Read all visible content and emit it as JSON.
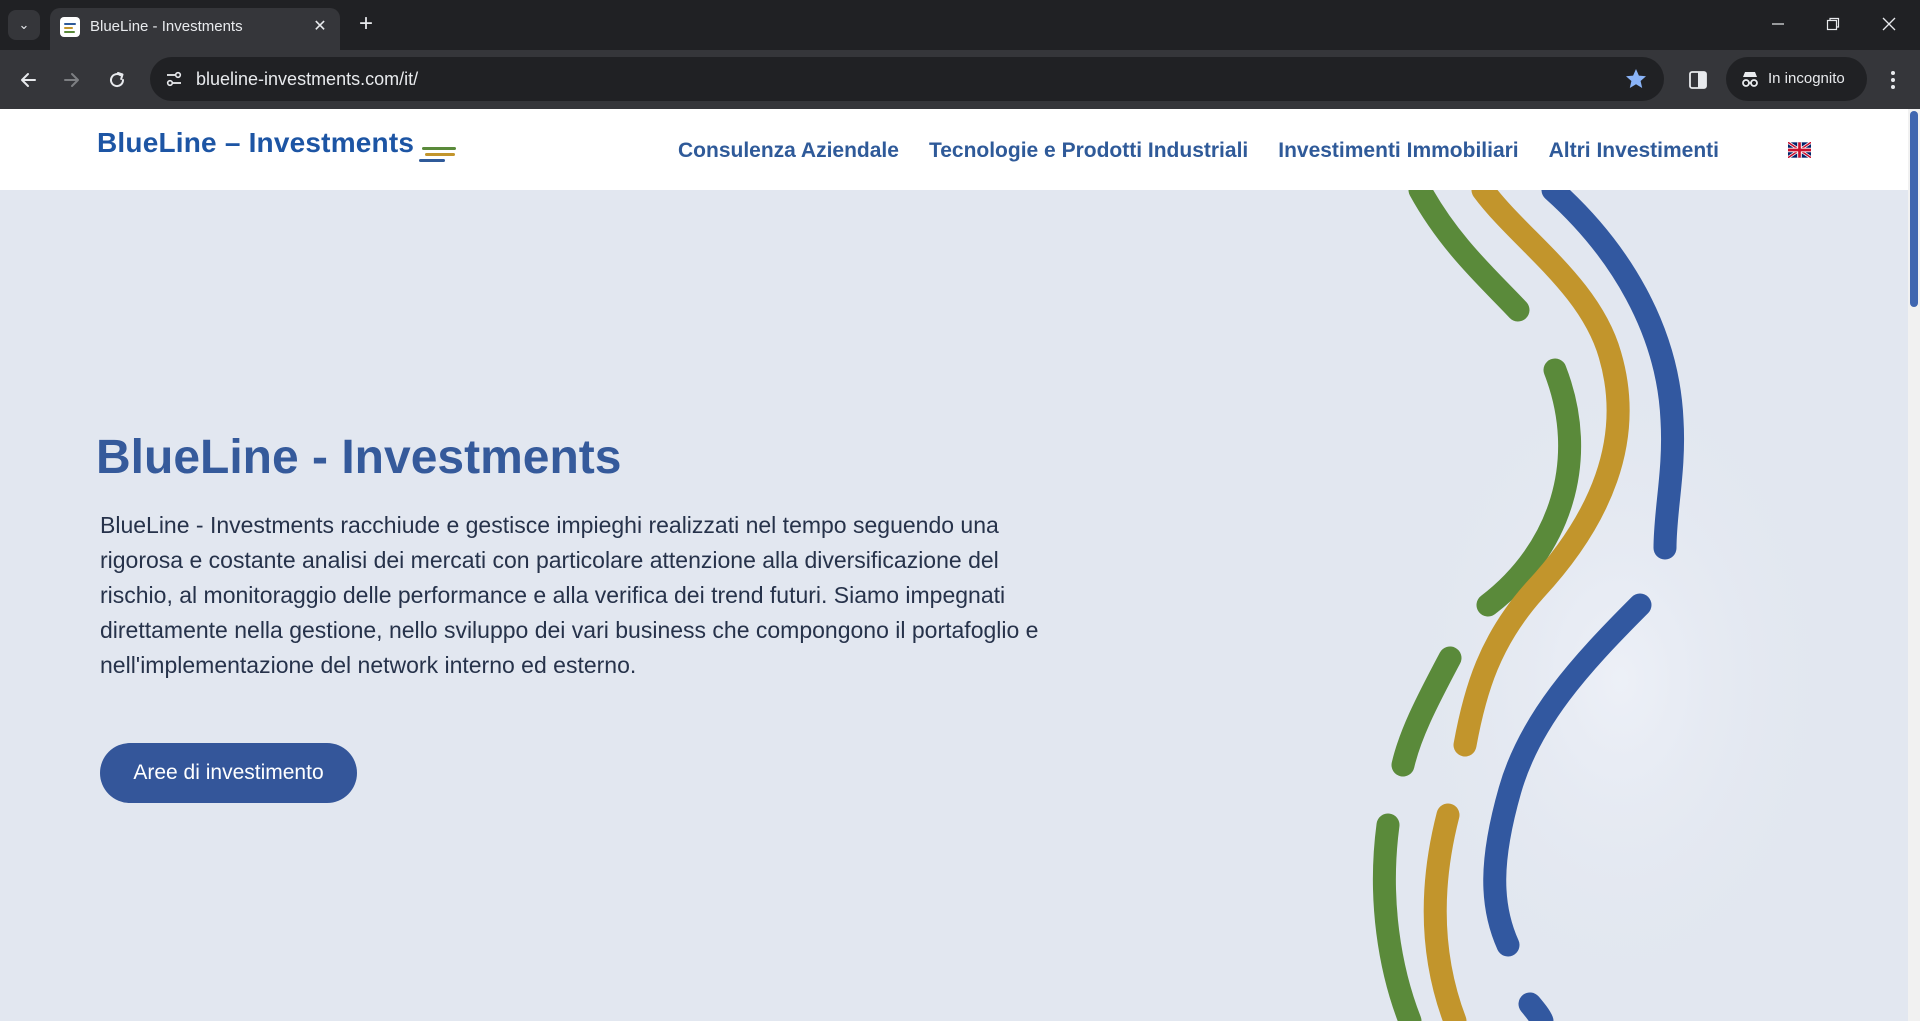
{
  "browser": {
    "tab_title": "BlueLine - Investments",
    "url": "blueline-investments.com/it/",
    "incognito_label": "In incognito",
    "icons": [
      "tab-search-icon",
      "favicon-icon",
      "close-icon",
      "plus-icon",
      "minimize-icon",
      "restore-icon",
      "window-close-icon",
      "back-icon",
      "forward-icon",
      "reload-icon",
      "site-info-icon",
      "bookmark-star-icon",
      "side-panel-icon",
      "incognito-icon",
      "more-vertical-icon"
    ]
  },
  "header": {
    "brand": "BlueLine – Investments",
    "nav": [
      "Consulenza Aziendale",
      "Tecnologie e Prodotti Industriali",
      "Investimenti Immobiliari",
      "Altri Investimenti"
    ],
    "language_flag": "uk-flag-icon"
  },
  "hero": {
    "title": "BlueLine - Investments",
    "text": "BlueLine - Investments racchiude e gestisce impieghi realizzati nel tempo seguendo una rigorosa e costante analisi dei mercati con particolare attenzione alla diversificazione del rischio, al monitoraggio delle performance e alla verifica dei trend futuri. Siamo impegnati direttamente nella gestione, nello sviluppo dei vari business che compongono il portafoglio e nell'implementazione del network interno ed esterno.",
    "button": "Aree di investimento"
  },
  "colors": {
    "brand_blue": "#1d55a4",
    "nav_blue": "#2f5a99",
    "button_blue": "#34569a",
    "stripe_green": "#5a8a3a",
    "stripe_gold": "#c2952c",
    "stripe_blue": "#3258a0",
    "hero_bg": "#e2e7f0"
  }
}
